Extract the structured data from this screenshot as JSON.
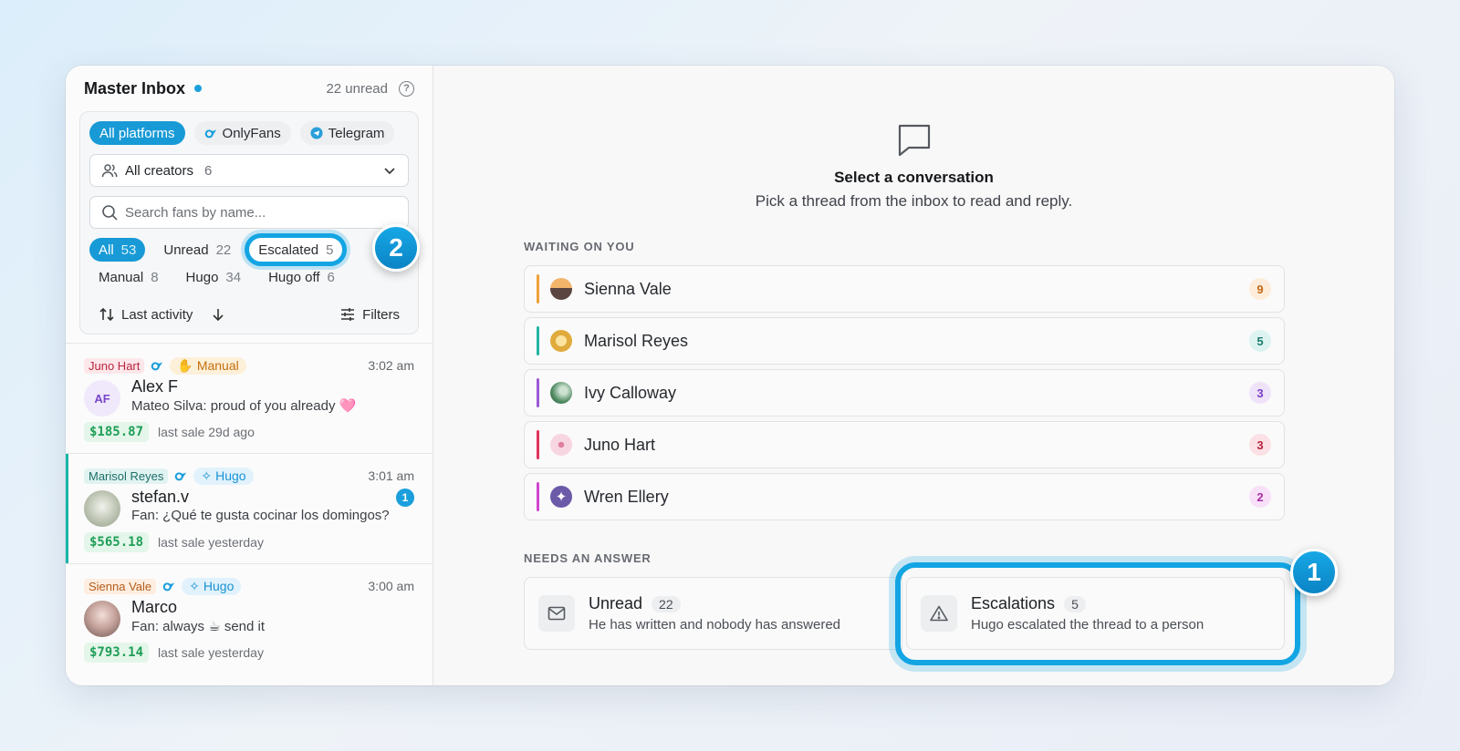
{
  "sidebar": {
    "title": "Master Inbox",
    "unread_label": "22 unread",
    "help": "?",
    "platforms": [
      "All platforms",
      "OnlyFans",
      "Telegram"
    ],
    "creator_select": {
      "label": "All creators",
      "count": "6"
    },
    "search_placeholder": "Search fans by name...",
    "tabs": [
      {
        "label": "All",
        "count": "53"
      },
      {
        "label": "Unread",
        "count": "22"
      },
      {
        "label": "Escalated",
        "count": "5"
      },
      {
        "label": "Manual",
        "count": "8"
      },
      {
        "label": "Hugo",
        "count": "34"
      },
      {
        "label": "Hugo off",
        "count": "6"
      }
    ],
    "sort_label": "Last activity",
    "filters_label": "Filters"
  },
  "conversations": [
    {
      "creator": "Juno Hart",
      "mode": "Manual",
      "time": "3:02 am",
      "initials": "AF",
      "name": "Alex F",
      "message": "Mateo Silva: proud of you already 🩷",
      "amount": "$185.87",
      "last_sale": "last sale 29d ago"
    },
    {
      "creator": "Marisol Reyes",
      "mode": "Hugo",
      "time": "3:01 am",
      "unread": "1",
      "name": "stefan.v",
      "message": "Fan: ¿Qué te gusta cocinar los domingos?",
      "amount": "$565.18",
      "last_sale": "last sale yesterday"
    },
    {
      "creator": "Sienna Vale",
      "mode": "Hugo",
      "time": "3:00 am",
      "name": "Marco",
      "message": "Fan: always ☕ send it",
      "amount": "$793.14",
      "last_sale": "last sale yesterday"
    }
  ],
  "main": {
    "empty_title": "Select a conversation",
    "empty_subtitle": "Pick a thread from the inbox to read and reply.",
    "waiting_label": "WAITING ON YOU",
    "waiting": [
      {
        "name": "Sienna Vale",
        "count": "9",
        "color": "#f0a13a"
      },
      {
        "name": "Marisol Reyes",
        "count": "5",
        "color": "#22b5a4"
      },
      {
        "name": "Ivy Calloway",
        "count": "3",
        "color": "#9b59d6"
      },
      {
        "name": "Juno Hart",
        "count": "3",
        "color": "#e0345a"
      },
      {
        "name": "Wren Ellery",
        "count": "2",
        "color": "#cf46cf"
      }
    ],
    "needs_label": "NEEDS AN ANSWER",
    "unread_card": {
      "title": "Unread",
      "count": "22",
      "desc": "He has written and nobody has answered"
    },
    "escalations_card": {
      "title": "Escalations",
      "count": "5",
      "desc": "Hugo escalated the thread to a person"
    }
  },
  "callouts": [
    "1",
    "2"
  ],
  "colors": {
    "accent": "#189ad6",
    "highlight": "#13a5e3"
  }
}
